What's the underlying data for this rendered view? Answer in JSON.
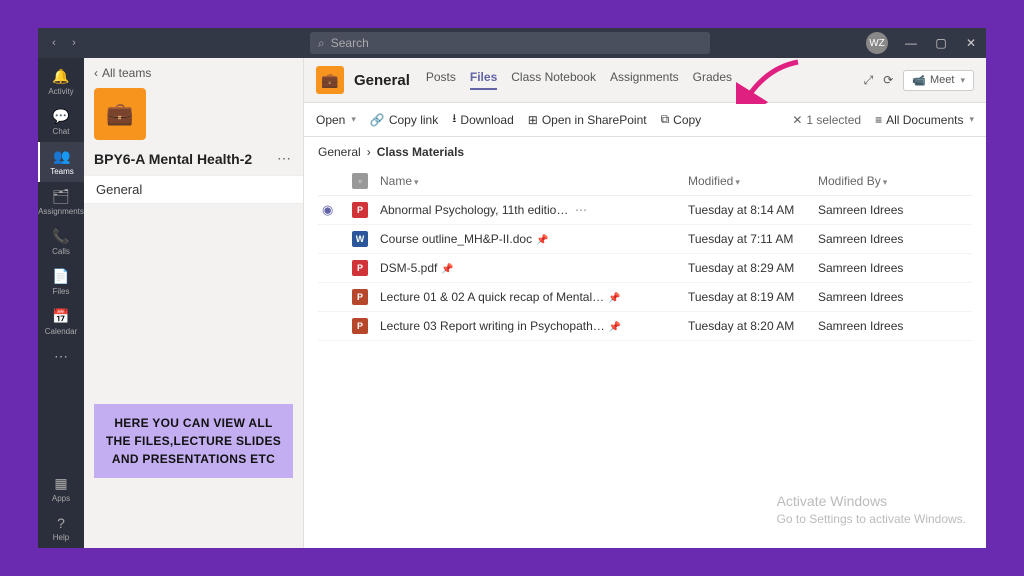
{
  "titlebar": {
    "search_placeholder": "Search",
    "avatar_initials": "WZ"
  },
  "rail": {
    "items": [
      {
        "label": "Activity",
        "icon": "🔔"
      },
      {
        "label": "Chat",
        "icon": "💬"
      },
      {
        "label": "Teams",
        "icon": "👥",
        "active": true
      },
      {
        "label": "Assignments",
        "icon": "🗂"
      },
      {
        "label": "Calls",
        "icon": "📞"
      },
      {
        "label": "Files",
        "icon": "📄"
      },
      {
        "label": "Calendar",
        "icon": "📅"
      },
      {
        "label": "",
        "icon": "⋯"
      }
    ],
    "bottom": [
      {
        "label": "Apps",
        "icon": "▦"
      },
      {
        "label": "Help",
        "icon": "?"
      }
    ]
  },
  "leftpanel": {
    "back_label": "All teams",
    "team_name": "BPY6-A Mental Health-2",
    "channels": [
      "General"
    ]
  },
  "annotation": "HERE YOU CAN VIEW ALL THE FILES,LECTURE SLIDES AND PRESENTATIONS ETC",
  "header": {
    "channel_title": "General",
    "tabs": [
      "Posts",
      "Files",
      "Class Notebook",
      "Assignments",
      "Grades"
    ],
    "active_tab": 1,
    "meet_label": "Meet"
  },
  "actionbar": {
    "open": "Open",
    "copylink": "Copy link",
    "download": "Download",
    "sharepoint": "Open in SharePoint",
    "copy": "Copy",
    "selected_label": "1 selected",
    "view_label": "All Documents"
  },
  "breadcrumb": [
    "General",
    "Class Materials"
  ],
  "columns": {
    "name": "Name",
    "modified": "Modified",
    "modified_by": "Modified By"
  },
  "files": [
    {
      "icon": "pdf",
      "name": "Abnormal Psychology, 11th editio…",
      "modified": "Tuesday at 8:14 AM",
      "by": "Samreen Idrees",
      "selected": true,
      "pinned": false,
      "menu": true
    },
    {
      "icon": "doc",
      "name": "Course outline_MH&P-II.doc",
      "modified": "Tuesday at 7:11 AM",
      "by": "Samreen Idrees",
      "selected": false,
      "pinned": true,
      "menu": false
    },
    {
      "icon": "pdf",
      "name": "DSM-5.pdf",
      "modified": "Tuesday at 8:29 AM",
      "by": "Samreen Idrees",
      "selected": false,
      "pinned": true,
      "menu": false
    },
    {
      "icon": "ppt",
      "name": "Lecture 01 & 02 A quick recap of Mental…",
      "modified": "Tuesday at 8:19 AM",
      "by": "Samreen Idrees",
      "selected": false,
      "pinned": true,
      "menu": false
    },
    {
      "icon": "ppt",
      "name": "Lecture 03 Report writing in Psychopath…",
      "modified": "Tuesday at 8:20 AM",
      "by": "Samreen Idrees",
      "selected": false,
      "pinned": true,
      "menu": false
    }
  ],
  "watermark": {
    "line1": "Activate Windows",
    "line2": "Go to Settings to activate Windows."
  }
}
